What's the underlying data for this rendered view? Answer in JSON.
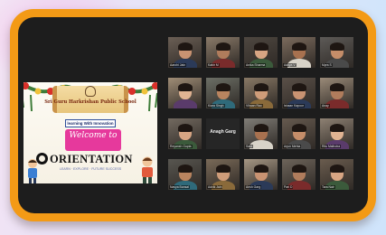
{
  "slide": {
    "school_name": "Sri Guru Harkrishan Public School",
    "tagline": "learning With Innovation",
    "welcome_line1": "Welcome to",
    "welcome_line2": "",
    "orientation_initial": "O",
    "orientation_rest": "RIENTATION",
    "subline": "LEARN · EXPLORE · FUTURE SUCCESS"
  },
  "participants": [
    {
      "name": "Aarohi Jain"
    },
    {
      "name": "Kabir M"
    },
    {
      "name": "Anika Sharma"
    },
    {
      "name": "Aditya V"
    },
    {
      "name": "Myra S"
    },
    {
      "name": ""
    },
    {
      "name": "Kiara Singh"
    },
    {
      "name": "Vihaan Rao"
    },
    {
      "name": "Ishaan Kapoor"
    },
    {
      "name": "Anay"
    },
    {
      "name": "Reyansh Gupta"
    },
    {
      "name": "Sara"
    },
    {
      "name": "Arjun Mehta"
    },
    {
      "name": "Ritu Malhotra"
    },
    {
      "name": "Navya Bansal"
    },
    {
      "name": "Advik Jain"
    },
    {
      "name": "Ansh Garg"
    },
    {
      "name": "Pari D"
    },
    {
      "name": "Tara Nair"
    },
    {
      "name": "Samarth"
    },
    {
      "name": "Dhruv Arora"
    },
    {
      "name": "Vivaan"
    },
    {
      "name": "Reva Singh"
    },
    {
      "name": "Kavya"
    }
  ],
  "no_video_participant": {
    "name": "Anagh Garg"
  },
  "colors": {
    "frame": "#f39a16",
    "screen": "#1d1d1d",
    "welcome_banner": "#e6399c",
    "active_speaker_border": "#f2d52a"
  }
}
